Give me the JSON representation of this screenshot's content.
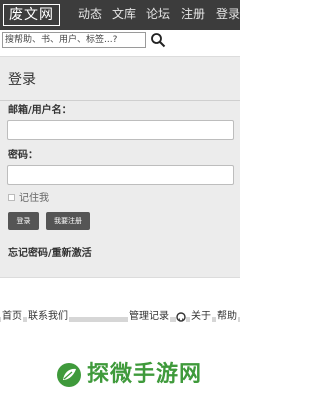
{
  "header": {
    "logo": "废文网",
    "nav": [
      "动态",
      "文库",
      "论坛",
      "注册",
      "登录"
    ]
  },
  "search": {
    "placeholder": "搜帮助、书、用户、标签...?"
  },
  "login": {
    "title": "登录",
    "email_label": "邮箱/用户名：",
    "password_label": "密码：",
    "remember_label": "记住我",
    "login_button": "登录",
    "register_button": "我要注册",
    "forgot_link": "忘记密码/重新激活"
  },
  "footer": {
    "home": "首页",
    "contact": "联系我们",
    "admin_log": "管理记录",
    "about": "关于",
    "help": "帮助"
  },
  "watermark": {
    "text": "探微手游网",
    "color": "#3f9a3b"
  }
}
